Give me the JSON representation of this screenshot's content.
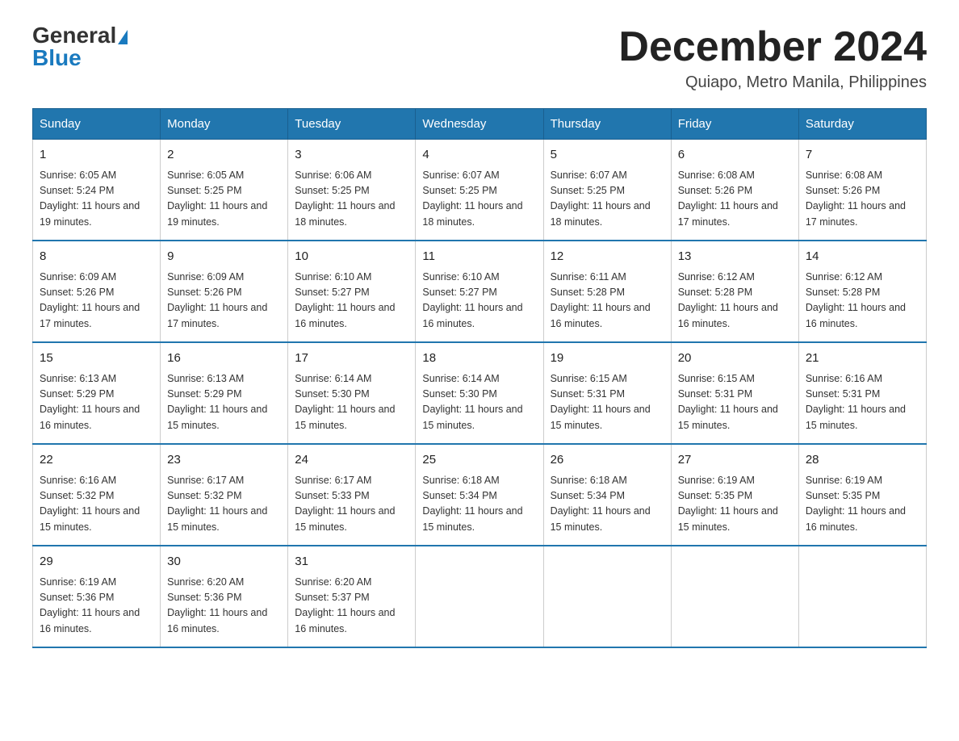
{
  "header": {
    "logo_general": "General",
    "logo_blue": "Blue",
    "month_title": "December 2024",
    "location": "Quiapo, Metro Manila, Philippines"
  },
  "days_of_week": [
    "Sunday",
    "Monday",
    "Tuesday",
    "Wednesday",
    "Thursday",
    "Friday",
    "Saturday"
  ],
  "weeks": [
    [
      {
        "num": "1",
        "sunrise": "6:05 AM",
        "sunset": "5:24 PM",
        "daylight": "11 hours and 19 minutes."
      },
      {
        "num": "2",
        "sunrise": "6:05 AM",
        "sunset": "5:25 PM",
        "daylight": "11 hours and 19 minutes."
      },
      {
        "num": "3",
        "sunrise": "6:06 AM",
        "sunset": "5:25 PM",
        "daylight": "11 hours and 18 minutes."
      },
      {
        "num": "4",
        "sunrise": "6:07 AM",
        "sunset": "5:25 PM",
        "daylight": "11 hours and 18 minutes."
      },
      {
        "num": "5",
        "sunrise": "6:07 AM",
        "sunset": "5:25 PM",
        "daylight": "11 hours and 18 minutes."
      },
      {
        "num": "6",
        "sunrise": "6:08 AM",
        "sunset": "5:26 PM",
        "daylight": "11 hours and 17 minutes."
      },
      {
        "num": "7",
        "sunrise": "6:08 AM",
        "sunset": "5:26 PM",
        "daylight": "11 hours and 17 minutes."
      }
    ],
    [
      {
        "num": "8",
        "sunrise": "6:09 AM",
        "sunset": "5:26 PM",
        "daylight": "11 hours and 17 minutes."
      },
      {
        "num": "9",
        "sunrise": "6:09 AM",
        "sunset": "5:26 PM",
        "daylight": "11 hours and 17 minutes."
      },
      {
        "num": "10",
        "sunrise": "6:10 AM",
        "sunset": "5:27 PM",
        "daylight": "11 hours and 16 minutes."
      },
      {
        "num": "11",
        "sunrise": "6:10 AM",
        "sunset": "5:27 PM",
        "daylight": "11 hours and 16 minutes."
      },
      {
        "num": "12",
        "sunrise": "6:11 AM",
        "sunset": "5:28 PM",
        "daylight": "11 hours and 16 minutes."
      },
      {
        "num": "13",
        "sunrise": "6:12 AM",
        "sunset": "5:28 PM",
        "daylight": "11 hours and 16 minutes."
      },
      {
        "num": "14",
        "sunrise": "6:12 AM",
        "sunset": "5:28 PM",
        "daylight": "11 hours and 16 minutes."
      }
    ],
    [
      {
        "num": "15",
        "sunrise": "6:13 AM",
        "sunset": "5:29 PM",
        "daylight": "11 hours and 16 minutes."
      },
      {
        "num": "16",
        "sunrise": "6:13 AM",
        "sunset": "5:29 PM",
        "daylight": "11 hours and 15 minutes."
      },
      {
        "num": "17",
        "sunrise": "6:14 AM",
        "sunset": "5:30 PM",
        "daylight": "11 hours and 15 minutes."
      },
      {
        "num": "18",
        "sunrise": "6:14 AM",
        "sunset": "5:30 PM",
        "daylight": "11 hours and 15 minutes."
      },
      {
        "num": "19",
        "sunrise": "6:15 AM",
        "sunset": "5:31 PM",
        "daylight": "11 hours and 15 minutes."
      },
      {
        "num": "20",
        "sunrise": "6:15 AM",
        "sunset": "5:31 PM",
        "daylight": "11 hours and 15 minutes."
      },
      {
        "num": "21",
        "sunrise": "6:16 AM",
        "sunset": "5:31 PM",
        "daylight": "11 hours and 15 minutes."
      }
    ],
    [
      {
        "num": "22",
        "sunrise": "6:16 AM",
        "sunset": "5:32 PM",
        "daylight": "11 hours and 15 minutes."
      },
      {
        "num": "23",
        "sunrise": "6:17 AM",
        "sunset": "5:32 PM",
        "daylight": "11 hours and 15 minutes."
      },
      {
        "num": "24",
        "sunrise": "6:17 AM",
        "sunset": "5:33 PM",
        "daylight": "11 hours and 15 minutes."
      },
      {
        "num": "25",
        "sunrise": "6:18 AM",
        "sunset": "5:34 PM",
        "daylight": "11 hours and 15 minutes."
      },
      {
        "num": "26",
        "sunrise": "6:18 AM",
        "sunset": "5:34 PM",
        "daylight": "11 hours and 15 minutes."
      },
      {
        "num": "27",
        "sunrise": "6:19 AM",
        "sunset": "5:35 PM",
        "daylight": "11 hours and 15 minutes."
      },
      {
        "num": "28",
        "sunrise": "6:19 AM",
        "sunset": "5:35 PM",
        "daylight": "11 hours and 16 minutes."
      }
    ],
    [
      {
        "num": "29",
        "sunrise": "6:19 AM",
        "sunset": "5:36 PM",
        "daylight": "11 hours and 16 minutes."
      },
      {
        "num": "30",
        "sunrise": "6:20 AM",
        "sunset": "5:36 PM",
        "daylight": "11 hours and 16 minutes."
      },
      {
        "num": "31",
        "sunrise": "6:20 AM",
        "sunset": "5:37 PM",
        "daylight": "11 hours and 16 minutes."
      },
      null,
      null,
      null,
      null
    ]
  ]
}
